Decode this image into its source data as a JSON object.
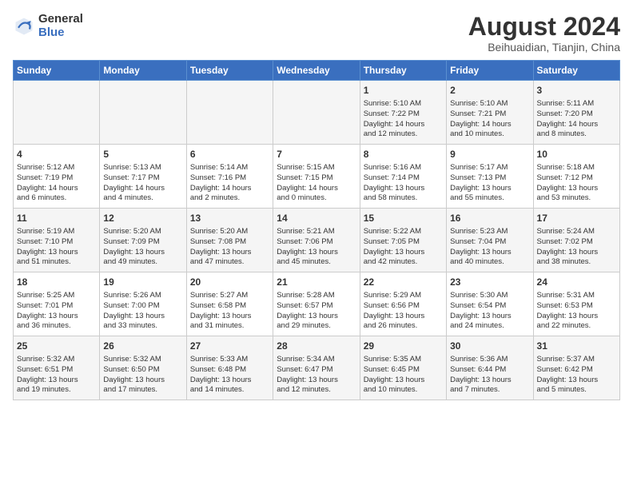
{
  "header": {
    "logo_general": "General",
    "logo_blue": "Blue",
    "month_title": "August 2024",
    "location": "Beihuaidian, Tianjin, China"
  },
  "weekdays": [
    "Sunday",
    "Monday",
    "Tuesday",
    "Wednesday",
    "Thursday",
    "Friday",
    "Saturday"
  ],
  "weeks": [
    [
      {
        "day": "",
        "content": ""
      },
      {
        "day": "",
        "content": ""
      },
      {
        "day": "",
        "content": ""
      },
      {
        "day": "",
        "content": ""
      },
      {
        "day": "1",
        "content": "Sunrise: 5:10 AM\nSunset: 7:22 PM\nDaylight: 14 hours\nand 12 minutes."
      },
      {
        "day": "2",
        "content": "Sunrise: 5:10 AM\nSunset: 7:21 PM\nDaylight: 14 hours\nand 10 minutes."
      },
      {
        "day": "3",
        "content": "Sunrise: 5:11 AM\nSunset: 7:20 PM\nDaylight: 14 hours\nand 8 minutes."
      }
    ],
    [
      {
        "day": "4",
        "content": "Sunrise: 5:12 AM\nSunset: 7:19 PM\nDaylight: 14 hours\nand 6 minutes."
      },
      {
        "day": "5",
        "content": "Sunrise: 5:13 AM\nSunset: 7:17 PM\nDaylight: 14 hours\nand 4 minutes."
      },
      {
        "day": "6",
        "content": "Sunrise: 5:14 AM\nSunset: 7:16 PM\nDaylight: 14 hours\nand 2 minutes."
      },
      {
        "day": "7",
        "content": "Sunrise: 5:15 AM\nSunset: 7:15 PM\nDaylight: 14 hours\nand 0 minutes."
      },
      {
        "day": "8",
        "content": "Sunrise: 5:16 AM\nSunset: 7:14 PM\nDaylight: 13 hours\nand 58 minutes."
      },
      {
        "day": "9",
        "content": "Sunrise: 5:17 AM\nSunset: 7:13 PM\nDaylight: 13 hours\nand 55 minutes."
      },
      {
        "day": "10",
        "content": "Sunrise: 5:18 AM\nSunset: 7:12 PM\nDaylight: 13 hours\nand 53 minutes."
      }
    ],
    [
      {
        "day": "11",
        "content": "Sunrise: 5:19 AM\nSunset: 7:10 PM\nDaylight: 13 hours\nand 51 minutes."
      },
      {
        "day": "12",
        "content": "Sunrise: 5:20 AM\nSunset: 7:09 PM\nDaylight: 13 hours\nand 49 minutes."
      },
      {
        "day": "13",
        "content": "Sunrise: 5:20 AM\nSunset: 7:08 PM\nDaylight: 13 hours\nand 47 minutes."
      },
      {
        "day": "14",
        "content": "Sunrise: 5:21 AM\nSunset: 7:06 PM\nDaylight: 13 hours\nand 45 minutes."
      },
      {
        "day": "15",
        "content": "Sunrise: 5:22 AM\nSunset: 7:05 PM\nDaylight: 13 hours\nand 42 minutes."
      },
      {
        "day": "16",
        "content": "Sunrise: 5:23 AM\nSunset: 7:04 PM\nDaylight: 13 hours\nand 40 minutes."
      },
      {
        "day": "17",
        "content": "Sunrise: 5:24 AM\nSunset: 7:02 PM\nDaylight: 13 hours\nand 38 minutes."
      }
    ],
    [
      {
        "day": "18",
        "content": "Sunrise: 5:25 AM\nSunset: 7:01 PM\nDaylight: 13 hours\nand 36 minutes."
      },
      {
        "day": "19",
        "content": "Sunrise: 5:26 AM\nSunset: 7:00 PM\nDaylight: 13 hours\nand 33 minutes."
      },
      {
        "day": "20",
        "content": "Sunrise: 5:27 AM\nSunset: 6:58 PM\nDaylight: 13 hours\nand 31 minutes."
      },
      {
        "day": "21",
        "content": "Sunrise: 5:28 AM\nSunset: 6:57 PM\nDaylight: 13 hours\nand 29 minutes."
      },
      {
        "day": "22",
        "content": "Sunrise: 5:29 AM\nSunset: 6:56 PM\nDaylight: 13 hours\nand 26 minutes."
      },
      {
        "day": "23",
        "content": "Sunrise: 5:30 AM\nSunset: 6:54 PM\nDaylight: 13 hours\nand 24 minutes."
      },
      {
        "day": "24",
        "content": "Sunrise: 5:31 AM\nSunset: 6:53 PM\nDaylight: 13 hours\nand 22 minutes."
      }
    ],
    [
      {
        "day": "25",
        "content": "Sunrise: 5:32 AM\nSunset: 6:51 PM\nDaylight: 13 hours\nand 19 minutes."
      },
      {
        "day": "26",
        "content": "Sunrise: 5:32 AM\nSunset: 6:50 PM\nDaylight: 13 hours\nand 17 minutes."
      },
      {
        "day": "27",
        "content": "Sunrise: 5:33 AM\nSunset: 6:48 PM\nDaylight: 13 hours\nand 14 minutes."
      },
      {
        "day": "28",
        "content": "Sunrise: 5:34 AM\nSunset: 6:47 PM\nDaylight: 13 hours\nand 12 minutes."
      },
      {
        "day": "29",
        "content": "Sunrise: 5:35 AM\nSunset: 6:45 PM\nDaylight: 13 hours\nand 10 minutes."
      },
      {
        "day": "30",
        "content": "Sunrise: 5:36 AM\nSunset: 6:44 PM\nDaylight: 13 hours\nand 7 minutes."
      },
      {
        "day": "31",
        "content": "Sunrise: 5:37 AM\nSunset: 6:42 PM\nDaylight: 13 hours\nand 5 minutes."
      }
    ]
  ]
}
